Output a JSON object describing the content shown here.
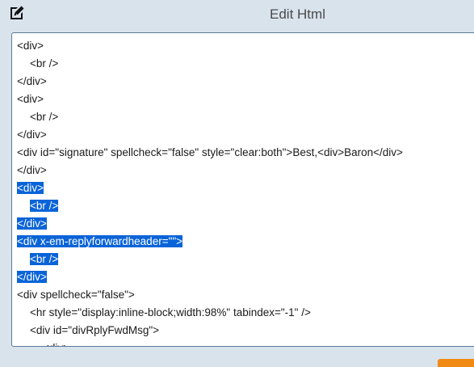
{
  "header": {
    "title": "Edit Html",
    "icon": "edit-pencil-icon"
  },
  "colors": {
    "background": "#d9e3ec",
    "selection": "#0a64d8",
    "action": "#f08a14",
    "editor_border": "#5a7a9a"
  },
  "editor": {
    "lines": [
      {
        "indent": 0,
        "text": "<div>",
        "selected": false
      },
      {
        "indent": 1,
        "text": "<br />",
        "selected": false
      },
      {
        "indent": 0,
        "text": "</div>",
        "selected": false
      },
      {
        "indent": 0,
        "text": "<div>",
        "selected": false
      },
      {
        "indent": 1,
        "text": "<br />",
        "selected": false
      },
      {
        "indent": 0,
        "text": "</div>",
        "selected": false
      },
      {
        "indent": 0,
        "text": "<div id=\"signature\" spellcheck=\"false\" style=\"clear:both\">Best,<div>Baron</div>",
        "selected": false
      },
      {
        "indent": 0,
        "text": "</div>",
        "selected": false
      },
      {
        "indent": 0,
        "text": "<div>",
        "selected": true
      },
      {
        "indent": 1,
        "text": "<br />",
        "selected": true
      },
      {
        "indent": 0,
        "text": "</div>",
        "selected": true
      },
      {
        "indent": 0,
        "text": "<div x-em-replyforwardheader=\"\">",
        "selected": true
      },
      {
        "indent": 1,
        "text": "<br />",
        "selected": true
      },
      {
        "indent": 0,
        "text": "</div>",
        "selected": true
      },
      {
        "indent": 0,
        "text": "<div spellcheck=\"false\">",
        "selected": false
      },
      {
        "indent": 1,
        "text": "<hr style=\"display:inline-block;width:98%\" tabindex=\"-1\" />",
        "selected": false
      },
      {
        "indent": 1,
        "text": "<div id=\"divRplyFwdMsg\">",
        "selected": false
      },
      {
        "indent": 2,
        "text": "<div>",
        "selected": false
      }
    ]
  }
}
